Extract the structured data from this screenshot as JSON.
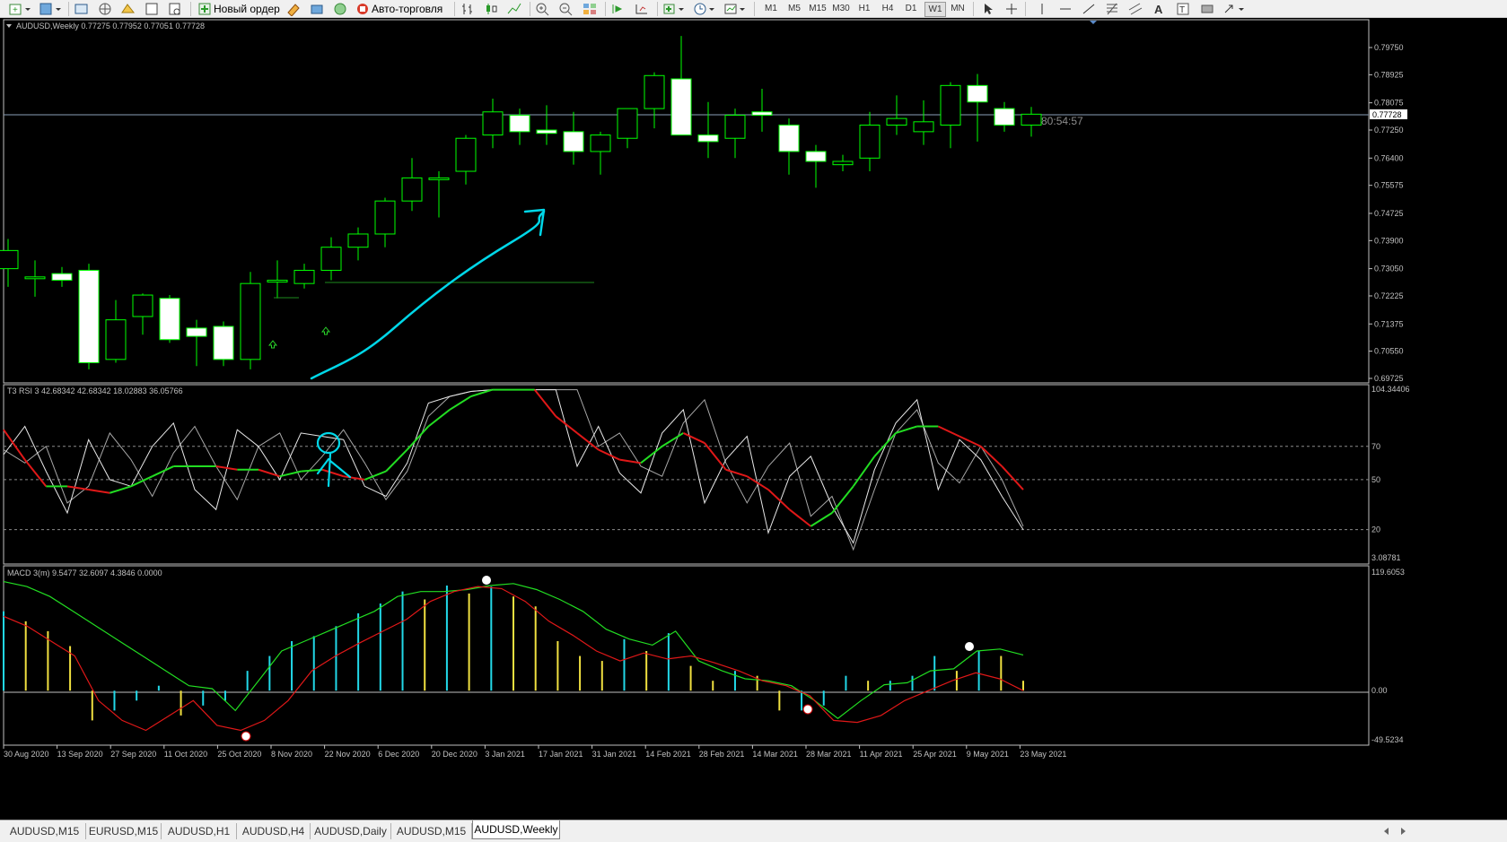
{
  "toolbar": {
    "new_order_label": "Новый ордер",
    "auto_trading_label": "Авто-торговля",
    "timeframes": [
      "M1",
      "M5",
      "M15",
      "M30",
      "H1",
      "H4",
      "D1",
      "W1",
      "MN"
    ]
  },
  "main_chart": {
    "header": "AUDUSD,Weekly  0.77275 0.77952 0.77051 0.77728",
    "current_price": "0.77728",
    "countdown": "« 80:54:57",
    "price_ticks": [
      "0.79750",
      "0.78925",
      "0.78075",
      "0.77250",
      "0.76400",
      "0.75575",
      "0.74725",
      "0.73900",
      "0.73050",
      "0.72225",
      "0.71375",
      "0.70550",
      "0.69725"
    ],
    "colors": {
      "background": "#000000",
      "bull_body": "#000000",
      "bear_body": "#ffffff",
      "wick": "#00ff00",
      "annotation": "#00d7e8"
    }
  },
  "rsi_panel": {
    "header": "T3 RSI 3 42.68342 42.68342 18.02883 36.05766",
    "ticks": [
      "104.34406",
      "70",
      "50",
      "20",
      "3.08781"
    ]
  },
  "macd_panel": {
    "header": "MACD 3(m) 9.5477 32.6097 4.3846 0.0000",
    "ticks": [
      "119.6053",
      "0.00",
      "-49.5234"
    ]
  },
  "time_axis": [
    "30 Aug 2020",
    "13 Sep 2020",
    "27 Sep 2020",
    "11 Oct 2020",
    "25 Oct 2020",
    "8 Nov 2020",
    "22 Nov 2020",
    "6 Dec 2020",
    "20 Dec 2020",
    "3 Jan 2021",
    "17 Jan 2021",
    "31 Jan 2021",
    "14 Feb 2021",
    "28 Feb 2021",
    "14 Mar 2021",
    "28 Mar 2021",
    "11 Apr 2021",
    "25 Apr 2021",
    "9 May 2021",
    "23 May 2021"
  ],
  "tabs": [
    "AUDUSD,M15",
    "EURUSD,M15",
    "AUDUSD,H1",
    "AUDUSD,H4",
    "AUDUSD,Daily",
    "AUDUSD,M15",
    "AUDUSD,Weekly"
  ],
  "active_tab": "AUDUSD,Weekly",
  "chart_data": {
    "type": "candlestick",
    "symbol": "AUDUSD",
    "timeframe": "Weekly",
    "candles": [
      {
        "o": 0.7305,
        "h": 0.7395,
        "l": 0.725,
        "c": 0.736
      },
      {
        "o": 0.728,
        "h": 0.733,
        "l": 0.722,
        "c": 0.728
      },
      {
        "o": 0.729,
        "h": 0.731,
        "l": 0.725,
        "c": 0.727
      },
      {
        "o": 0.73,
        "h": 0.732,
        "l": 0.7,
        "c": 0.702
      },
      {
        "o": 0.703,
        "h": 0.721,
        "l": 0.702,
        "c": 0.715
      },
      {
        "o": 0.716,
        "h": 0.723,
        "l": 0.7105,
        "c": 0.7225
      },
      {
        "o": 0.7215,
        "h": 0.7225,
        "l": 0.708,
        "c": 0.709
      },
      {
        "o": 0.7125,
        "h": 0.715,
        "l": 0.701,
        "c": 0.71
      },
      {
        "o": 0.713,
        "h": 0.7145,
        "l": 0.701,
        "c": 0.703
      },
      {
        "o": 0.703,
        "h": 0.7295,
        "l": 0.7,
        "c": 0.726
      },
      {
        "o": 0.727,
        "h": 0.733,
        "l": 0.7215,
        "c": 0.727
      },
      {
        "o": 0.726,
        "h": 0.732,
        "l": 0.7245,
        "c": 0.73
      },
      {
        "o": 0.73,
        "h": 0.74,
        "l": 0.727,
        "c": 0.737
      },
      {
        "o": 0.737,
        "h": 0.743,
        "l": 0.733,
        "c": 0.741
      },
      {
        "o": 0.741,
        "h": 0.752,
        "l": 0.737,
        "c": 0.751
      },
      {
        "o": 0.751,
        "h": 0.764,
        "l": 0.748,
        "c": 0.758
      },
      {
        "o": 0.758,
        "h": 0.76,
        "l": 0.746,
        "c": 0.758
      },
      {
        "o": 0.76,
        "h": 0.771,
        "l": 0.756,
        "c": 0.77
      },
      {
        "o": 0.771,
        "h": 0.782,
        "l": 0.767,
        "c": 0.778
      },
      {
        "o": 0.777,
        "h": 0.779,
        "l": 0.768,
        "c": 0.772
      },
      {
        "o": 0.7725,
        "h": 0.78,
        "l": 0.768,
        "c": 0.7715
      },
      {
        "o": 0.772,
        "h": 0.778,
        "l": 0.762,
        "c": 0.766
      },
      {
        "o": 0.766,
        "h": 0.772,
        "l": 0.759,
        "c": 0.771
      },
      {
        "o": 0.77,
        "h": 0.779,
        "l": 0.767,
        "c": 0.779
      },
      {
        "o": 0.779,
        "h": 0.79,
        "l": 0.773,
        "c": 0.789
      },
      {
        "o": 0.788,
        "h": 0.801,
        "l": 0.771,
        "c": 0.771
      },
      {
        "o": 0.771,
        "h": 0.781,
        "l": 0.764,
        "c": 0.769
      },
      {
        "o": 0.77,
        "h": 0.779,
        "l": 0.764,
        "c": 0.777
      },
      {
        "o": 0.778,
        "h": 0.785,
        "l": 0.772,
        "c": 0.777
      },
      {
        "o": 0.774,
        "h": 0.776,
        "l": 0.759,
        "c": 0.766
      },
      {
        "o": 0.766,
        "h": 0.768,
        "l": 0.755,
        "c": 0.763
      },
      {
        "o": 0.762,
        "h": 0.765,
        "l": 0.76,
        "c": 0.763
      },
      {
        "o": 0.764,
        "h": 0.778,
        "l": 0.76,
        "c": 0.774
      },
      {
        "o": 0.774,
        "h": 0.783,
        "l": 0.771,
        "c": 0.776
      },
      {
        "o": 0.772,
        "h": 0.7815,
        "l": 0.768,
        "c": 0.775
      },
      {
        "o": 0.774,
        "h": 0.787,
        "l": 0.767,
        "c": 0.786
      },
      {
        "o": 0.786,
        "h": 0.7895,
        "l": 0.769,
        "c": 0.781
      },
      {
        "o": 0.779,
        "h": 0.781,
        "l": 0.772,
        "c": 0.774
      },
      {
        "o": 0.774,
        "h": 0.7795,
        "l": 0.7705,
        "c": 0.7773
      }
    ],
    "rsi_levels": [
      70,
      50,
      20
    ],
    "rsi_t3": [
      80,
      62,
      46,
      46,
      44,
      42,
      46,
      52,
      58,
      58,
      58,
      56,
      56,
      52,
      55,
      56,
      52,
      50,
      55,
      68,
      82,
      92,
      100,
      104,
      104,
      104,
      88,
      78,
      68,
      62,
      60,
      70,
      78,
      72,
      56,
      52,
      44,
      32,
      22,
      30,
      46,
      64,
      78,
      82,
      82,
      76,
      70,
      58,
      44
    ],
    "rsi_fast": [
      65,
      82,
      55,
      30,
      74,
      50,
      46,
      70,
      84,
      44,
      32,
      80,
      70,
      50,
      78,
      76,
      74,
      46,
      40,
      60,
      96,
      100,
      103,
      104,
      104,
      104,
      104,
      58,
      82,
      54,
      42,
      78,
      92,
      36,
      62,
      76,
      18,
      52,
      64,
      34,
      12,
      56,
      84,
      98,
      44,
      74,
      62,
      40,
      20
    ],
    "rsi_slow": [
      68,
      60,
      70,
      36,
      46,
      78,
      62,
      40,
      66,
      82,
      58,
      38,
      70,
      78,
      50,
      64,
      80,
      60,
      38,
      55,
      88,
      100,
      103,
      104,
      104,
      104,
      104,
      104,
      70,
      78,
      58,
      52,
      84,
      98,
      60,
      36,
      58,
      72,
      28,
      40,
      8,
      44,
      78,
      92,
      60,
      48,
      70,
      50,
      22
    ],
    "macd_histogram": [
      80,
      70,
      60,
      45,
      -30,
      -20,
      -10,
      5,
      -25,
      -15,
      -10,
      20,
      35,
      50,
      55,
      65,
      78,
      88,
      100,
      92,
      106,
      98,
      105,
      95,
      85,
      50,
      35,
      30,
      52,
      40,
      58,
      25,
      10,
      20,
      15,
      -20,
      -20,
      -15,
      15,
      10,
      10,
      15,
      35,
      20,
      40,
      35,
      10
    ],
    "macd_signal": [
      110,
      105,
      95,
      80,
      65,
      50,
      35,
      20,
      5,
      2,
      -20,
      10,
      40,
      50,
      60,
      70,
      80,
      95,
      100,
      100,
      102,
      106,
      108,
      102,
      92,
      80,
      62,
      52,
      46,
      60,
      30,
      20,
      12,
      10,
      5,
      -10,
      -28,
      -10,
      6,
      8,
      20,
      22,
      40,
      42,
      36
    ],
    "macd_main": [
      75,
      65,
      50,
      35,
      -10,
      -30,
      -40,
      -25,
      -10,
      -35,
      -40,
      -30,
      -10,
      20,
      35,
      48,
      60,
      72,
      90,
      100,
      105,
      103,
      90,
      70,
      56,
      40,
      30,
      38,
      32,
      35,
      28,
      20,
      10,
      5,
      -5,
      -30,
      -32,
      -25,
      -10,
      0,
      10,
      18,
      12,
      0
    ]
  }
}
